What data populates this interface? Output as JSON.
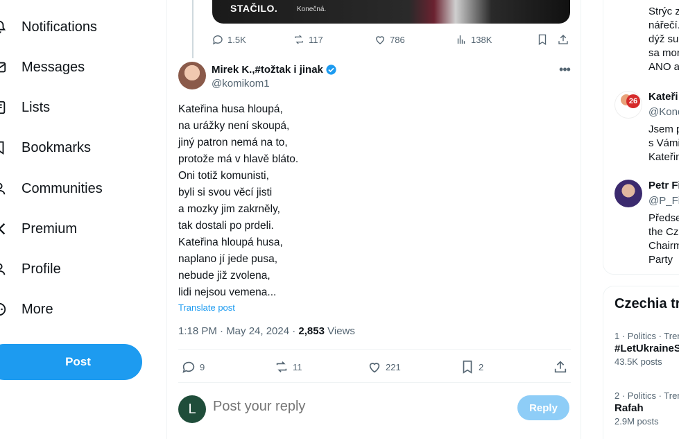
{
  "nav": {
    "items": [
      {
        "label": "Notifications",
        "icon": "bell-icon"
      },
      {
        "label": "Messages",
        "icon": "envelope-icon"
      },
      {
        "label": "Lists",
        "icon": "list-icon"
      },
      {
        "label": "Bookmarks",
        "icon": "bookmark-icon"
      },
      {
        "label": "Communities",
        "icon": "people-icon"
      },
      {
        "label": "Premium",
        "icon": "x-logo-icon"
      },
      {
        "label": "Profile",
        "icon": "person-icon"
      },
      {
        "label": "More",
        "icon": "more-circle-icon"
      }
    ],
    "post_label": "Post"
  },
  "prev_post": {
    "media_text": "STAČILO.",
    "media_subtext": "Konečná.",
    "replies": "1.5K",
    "reposts": "117",
    "likes": "786",
    "views": "138K"
  },
  "post": {
    "author_name": "Mirek K.,#tožtak i jinak",
    "author_handle": "@komikom1",
    "lines": [
      "Kateřina husa hloupá,",
      "na urážky není skoupá,",
      "jiný patron nemá na to,",
      "protože má v hlavě bláto.",
      "Oni totiž komunisti,",
      "byli si svou věcí jisti",
      "a mozky jim zakrněly,",
      "tak dostali po prdeli.",
      "Kateřina hloupá husa,",
      "naplano jí jede pusa,",
      "nebude již zvolena,",
      "lidi nejsou vemena..."
    ],
    "translate": "Translate post",
    "time": "1:18 PM · May 24, 2024 · ",
    "views_count": "2,853",
    "views_label": " Views",
    "replies": "9",
    "reposts": "11",
    "likes": "221",
    "bookmarks": "2"
  },
  "reply": {
    "avatar_letter": "L",
    "placeholder": "Post your reply",
    "button": "Reply"
  },
  "sidebar": {
    "partial_bio": [
      "Strýc z",
      "nářečí.",
      "dýž su",
      "sa mor",
      "ANO a"
    ],
    "who_to_follow": [
      {
        "name": "Kateři",
        "handle": "@Kone",
        "bio": [
          "Jsem p",
          "s Vámi",
          "Kateřin"
        ],
        "badge": "26"
      },
      {
        "name": "Petr Fi",
        "handle": "@P_Fia",
        "bio": [
          "Předse",
          "the Cze",
          "Chairm",
          "Party"
        ]
      }
    ],
    "trends_title": "Czechia tr",
    "trends": [
      {
        "category": "1 · Politics · Tren",
        "tag": "#LetUkraineS",
        "count": "43.5K posts"
      },
      {
        "category": "2 · Politics · Tren",
        "tag": "Rafah",
        "count": "2.9M posts"
      }
    ]
  },
  "colors": {
    "accent": "#1d9bf0",
    "verified": "#1d9bf0",
    "muted": "#536471",
    "reply_button_disabled": "#8ecdf7"
  }
}
